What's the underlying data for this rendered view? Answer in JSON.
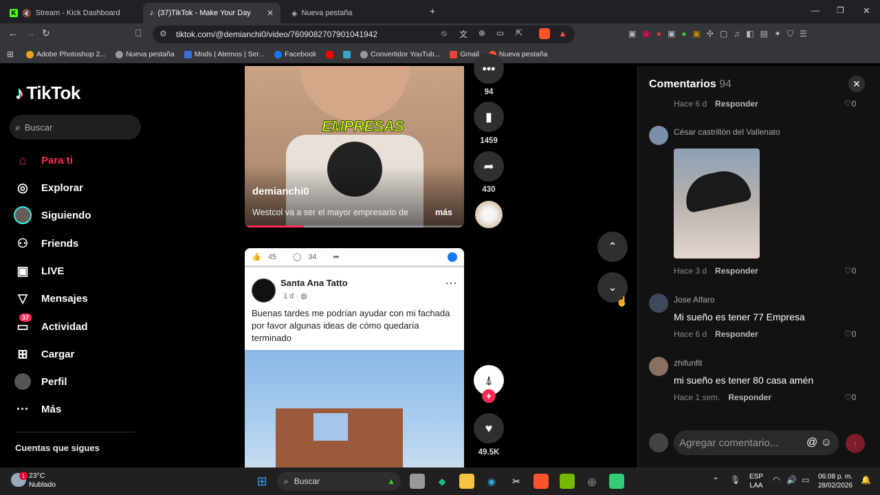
{
  "browser": {
    "tabs": [
      {
        "title": "Stream - Kick Dashboard",
        "icon": "kick-icon",
        "active": false
      },
      {
        "title": "(37)TikTok - Make Your Day",
        "icon": "tiktok-icon",
        "active": true
      },
      {
        "title": "Nueva pestaña",
        "icon": "brave-icon",
        "active": false
      }
    ],
    "url": "tiktok.com/@demianchi0/video/7609082707901041942",
    "bookmarks": [
      "Adobe Photoshop 2...",
      "Nueva pestaña",
      "Mods | Atemos | Ser...",
      "Facebook",
      "",
      "",
      "Convertidor YouTub...",
      "Gmail",
      "Nueva pestaña"
    ]
  },
  "sidebar": {
    "logo": "TikTok",
    "search_placeholder": "Buscar",
    "items": [
      {
        "label": "Para ti",
        "icon": "home-icon",
        "active": true
      },
      {
        "label": "Explorar",
        "icon": "compass-icon"
      },
      {
        "label": "Siguiendo",
        "icon": "following-avatar-icon"
      },
      {
        "label": "Friends",
        "icon": "friends-icon"
      },
      {
        "label": "LIVE",
        "icon": "live-icon"
      },
      {
        "label": "Mensajes",
        "icon": "message-icon"
      },
      {
        "label": "Actividad",
        "icon": "activity-icon",
        "badge": "37"
      },
      {
        "label": "Cargar",
        "icon": "upload-icon"
      },
      {
        "label": "Perfil",
        "icon": "profile-icon"
      },
      {
        "label": "Más",
        "icon": "more-icon"
      }
    ],
    "following_title": "Cuentas que sigues"
  },
  "video1": {
    "overlay_text": "EMPRESAS",
    "author": "demianchi0",
    "description": "Westcol va a ser el mayor empresario de",
    "more": "más",
    "progress": 0.27
  },
  "actions1": {
    "comments": "94",
    "saves": "1459",
    "shares": "430"
  },
  "video2": {
    "reactions": {
      "likes": "45",
      "comments": "34"
    },
    "page_name": "Santa Ana Tatto",
    "meta": "1 d ·",
    "post_text": "Buenas tardes me podrían ayudar con mi fachada por favor algunas ideas de cómo quedaría terminado"
  },
  "actions2": {
    "likes": "49.5K"
  },
  "comments": {
    "title": "Comentarios",
    "count": "94",
    "partial": {
      "time": "Hace 6 d",
      "reply": "Responder",
      "likes": "0"
    },
    "items": [
      {
        "name": "César castrillón del Vallenato",
        "text": "",
        "time": "Hace 3 d",
        "reply": "Responder",
        "likes": "0",
        "has_image": true
      },
      {
        "name": "Jose Alfaro",
        "text": "Mi sueño es tener 77 Empresa",
        "time": "Hace 6 d",
        "reply": "Responder",
        "likes": "0"
      },
      {
        "name": "zhifunfit",
        "text": "mi sueño es tener 80 casa amén",
        "time": "Hace 1 sem.",
        "reply": "Responder",
        "likes": "0"
      }
    ],
    "add_placeholder": "Agregar comentario..."
  },
  "taskbar": {
    "weather_temp": "23°C",
    "weather_desc": "Nublado",
    "search": "Buscar",
    "lang": "ESP",
    "region": "LAA",
    "time": "06:08 p. m.",
    "date": "28/02/2026"
  },
  "colors": {
    "accent": "#fe2c55",
    "bg": "#000000",
    "panel": "#121212"
  }
}
